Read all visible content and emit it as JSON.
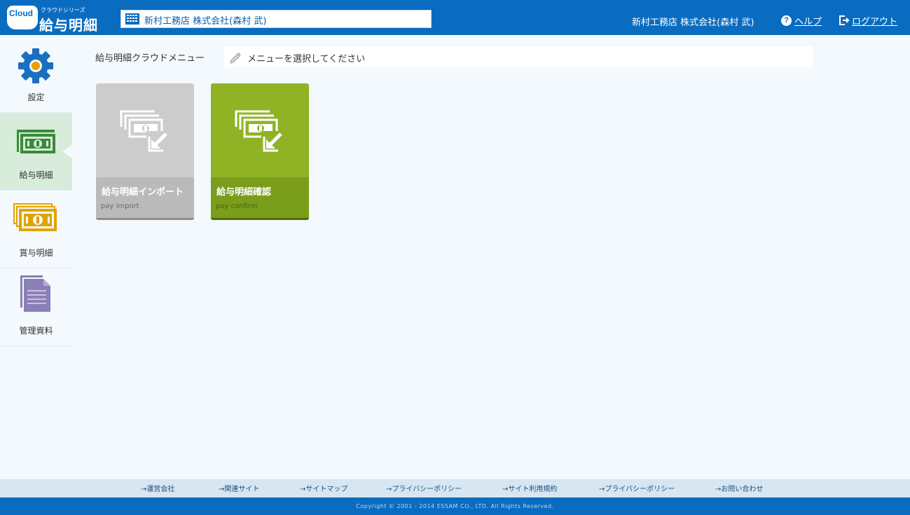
{
  "header": {
    "logo_cloud": "Cloud",
    "logo_series": "クラウドシリーズ",
    "logo_product": "給与明細",
    "company_name": "新村工務店 株式会社(森村 武)",
    "user_name": "新村工務店 株式会社(森村 武)",
    "help_label": "ヘルプ",
    "logout_label": "ログアウト"
  },
  "sidebar": {
    "items": [
      {
        "label": "設定",
        "icon": "gear-icon",
        "color": "#1b6fc0"
      },
      {
        "label": "給与明細",
        "icon": "pay-money-icon",
        "color": "#3a8a3a",
        "active": true
      },
      {
        "label": "賞与明細",
        "icon": "bonus-money-icon",
        "color": "#e0a400"
      },
      {
        "label": "管理資料",
        "icon": "documents-icon",
        "color": "#8a7fb6"
      }
    ]
  },
  "main": {
    "title": "給与明細クラウドメニュー",
    "message": "メニューを選択してください",
    "tiles": [
      {
        "label": "給与明細インポート",
        "sub": "pay import",
        "color": "#cccccc"
      },
      {
        "label": "給与明細確認",
        "sub": "pay confirm",
        "color": "#8fb325"
      }
    ]
  },
  "footer": {
    "links": [
      "→運営会社",
      "→関連サイト",
      "→サイトマップ",
      "→プライバシーポリシー",
      "→サイト利用規約",
      "→プライバシーポリシー",
      "→お問い合わせ"
    ],
    "copyright": "Copyright © 2001 - 2014 ESSAM CO., LTD. All Rights Reserved."
  }
}
